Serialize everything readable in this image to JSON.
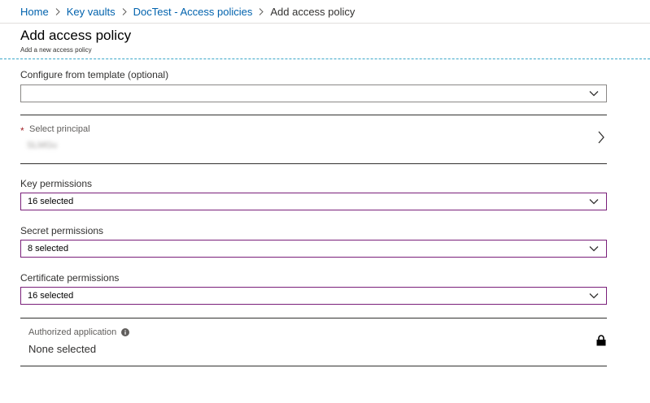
{
  "breadcrumb": {
    "items": [
      "Home",
      "Key vaults",
      "DocTest - Access policies"
    ],
    "current": "Add access policy"
  },
  "header": {
    "title": "Add access policy",
    "subtitle": "Add a new access policy"
  },
  "template": {
    "label": "Configure from template (optional)",
    "value": ""
  },
  "principal": {
    "required_marker": "*",
    "label": "Select principal",
    "value": "SLMGu"
  },
  "key_permissions": {
    "label": "Key permissions",
    "value": "16 selected"
  },
  "secret_permissions": {
    "label": "Secret permissions",
    "value": "8 selected"
  },
  "certificate_permissions": {
    "label": "Certificate permissions",
    "value": "16 selected"
  },
  "authorized_application": {
    "label": "Authorized application",
    "value": "None selected"
  },
  "colors": {
    "link": "#0062ad",
    "active_border": "#7a1f7a",
    "required": "#a4262c",
    "header_divider": "#3aa7c9"
  },
  "icons": {
    "breadcrumb_separator": "chevron-right-icon",
    "dropdown": "chevron-down-icon",
    "principal": "chevron-right-icon",
    "info": "info-icon",
    "lock": "lock-icon"
  }
}
